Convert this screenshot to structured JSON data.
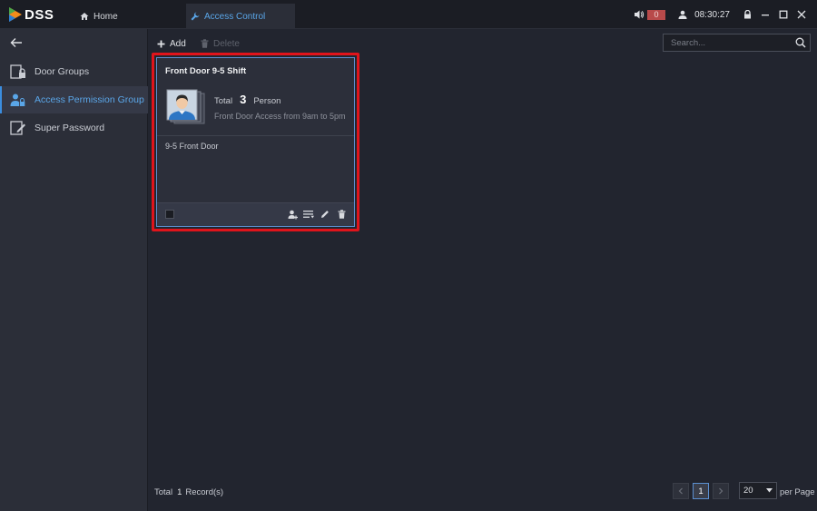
{
  "app": {
    "logo_text": "DSS"
  },
  "tabs": [
    {
      "label": "Home",
      "icon": "home-icon"
    },
    {
      "label": "Access Control",
      "icon": "wrench-icon",
      "active": true
    }
  ],
  "status": {
    "alarm_count": "0",
    "time": "08:30:27"
  },
  "sidebar": {
    "items": [
      {
        "label": "Door Groups",
        "icon": "door-lock-icon"
      },
      {
        "label": "Access Permission Group",
        "icon": "user-lock-icon",
        "active": true
      },
      {
        "label": "Super Password",
        "icon": "edit-key-icon"
      }
    ]
  },
  "toolbar": {
    "add_label": "Add",
    "delete_label": "Delete",
    "search_placeholder": "Search..."
  },
  "card": {
    "title": "Front Door 9-5 Shift",
    "total_label": "Total",
    "total_count": "3",
    "person_label": "Person",
    "description": "Front Door Access from 9am to 5pm",
    "door": "9-5 Front Door"
  },
  "footer": {
    "total_label": "Total",
    "record_count": "1",
    "record_label": "Record(s)",
    "current_page": "1",
    "per_page_value": "20",
    "per_page_label": "per Page"
  },
  "colors": {
    "accent": "#3b8ee0",
    "highlight": "#e0141b",
    "alarm": "#b84a4a"
  }
}
